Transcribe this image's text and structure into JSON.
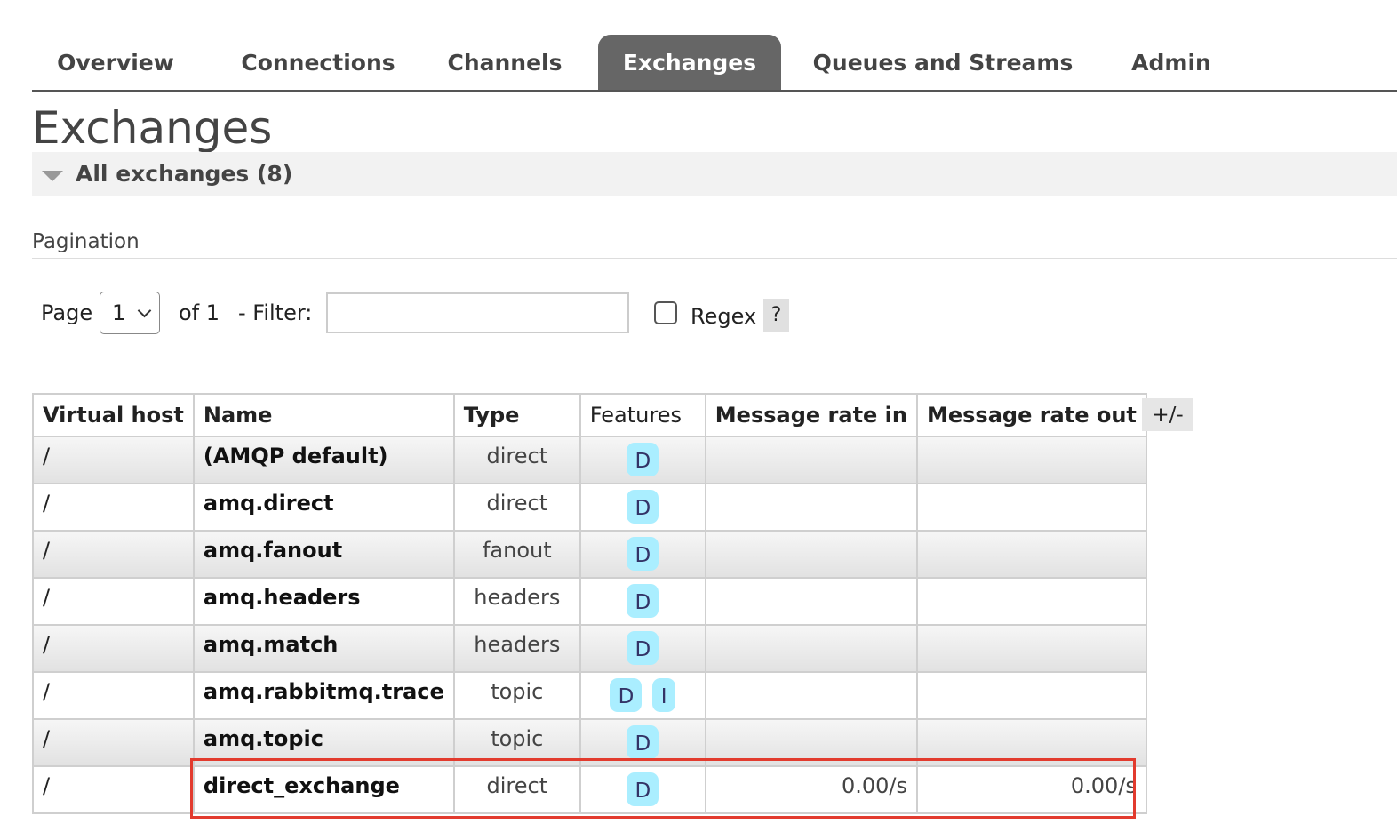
{
  "nav": {
    "tabs": [
      {
        "label": "Overview",
        "active": false
      },
      {
        "label": "Connections",
        "active": false
      },
      {
        "label": "Channels",
        "active": false
      },
      {
        "label": "Exchanges",
        "active": true
      },
      {
        "label": "Queues and Streams",
        "active": false
      },
      {
        "label": "Admin",
        "active": false
      }
    ]
  },
  "page": {
    "title": "Exchanges",
    "section_title": "All exchanges (8)",
    "section_icon": "triangle-down-icon"
  },
  "pagination": {
    "heading": "Pagination",
    "page_label": "Page",
    "page_value": "1",
    "of_label": "of 1",
    "filter_label": "- Filter:",
    "filter_value": "",
    "regex_label": "Regex",
    "regex_checked": false,
    "help_label": "?"
  },
  "table": {
    "columns": [
      "Virtual host",
      "Name",
      "Type",
      "Features",
      "Message rate in",
      "Message rate out"
    ],
    "column_toggle_label": "+/-",
    "rows": [
      {
        "vhost": "/",
        "name": "(AMQP default)",
        "type": "direct",
        "features": [
          "D"
        ],
        "rate_in": "",
        "rate_out": ""
      },
      {
        "vhost": "/",
        "name": "amq.direct",
        "type": "direct",
        "features": [
          "D"
        ],
        "rate_in": "",
        "rate_out": ""
      },
      {
        "vhost": "/",
        "name": "amq.fanout",
        "type": "fanout",
        "features": [
          "D"
        ],
        "rate_in": "",
        "rate_out": ""
      },
      {
        "vhost": "/",
        "name": "amq.headers",
        "type": "headers",
        "features": [
          "D"
        ],
        "rate_in": "",
        "rate_out": ""
      },
      {
        "vhost": "/",
        "name": "amq.match",
        "type": "headers",
        "features": [
          "D"
        ],
        "rate_in": "",
        "rate_out": ""
      },
      {
        "vhost": "/",
        "name": "amq.rabbitmq.trace",
        "type": "topic",
        "features": [
          "D",
          "I"
        ],
        "rate_in": "",
        "rate_out": ""
      },
      {
        "vhost": "/",
        "name": "amq.topic",
        "type": "topic",
        "features": [
          "D"
        ],
        "rate_in": "",
        "rate_out": ""
      },
      {
        "vhost": "/",
        "name": "direct_exchange",
        "type": "direct",
        "features": [
          "D"
        ],
        "rate_in": "0.00/s",
        "rate_out": "0.00/s"
      }
    ]
  },
  "colors": {
    "active_tab_bg": "#666666",
    "feature_badge_bg": "#aaeeff",
    "highlight_border": "#e23b2e"
  }
}
